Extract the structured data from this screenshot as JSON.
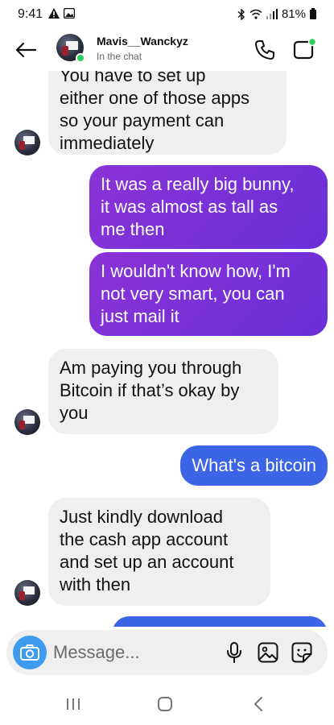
{
  "status_bar": {
    "time": "9:41",
    "battery": "81%"
  },
  "header": {
    "contact_name": "Mavis__Wanckyz",
    "contact_status": "In the chat"
  },
  "messages": [
    {
      "sender": "contact",
      "lines": [
        "You have to set up",
        "either one of those apps",
        "so your payment can",
        "immediately"
      ]
    },
    {
      "sender": "me",
      "lines": [
        "It was a really big bunny,",
        "it was almost as tall as",
        "me then"
      ]
    },
    {
      "sender": "me",
      "lines": [
        "I wouldn't know how, I'm",
        "not very smart, you can",
        "just mail it"
      ]
    },
    {
      "sender": "contact",
      "lines": [
        "Am paying you through",
        "Bitcoin if that’s okay by",
        "you"
      ]
    },
    {
      "sender": "me",
      "lines": [
        "What's a bitcoin"
      ]
    },
    {
      "sender": "contact",
      "lines": [
        "Just kindly download",
        "the cash app account",
        "and set up an account",
        "with then"
      ]
    }
  ],
  "composer": {
    "placeholder": "Message..."
  },
  "colors": {
    "outgoing_purple": "#7a31d8",
    "outgoing_blue": "#3b64e6",
    "incoming_bg": "#efefef",
    "camera_blue": "#3f9bef",
    "online_green": "#2ecc5a"
  },
  "icons": {
    "back": "arrow-left-icon",
    "call": "phone-icon",
    "video": "video-camera-icon",
    "camera": "camera-icon",
    "mic": "microphone-icon",
    "gallery": "image-icon",
    "sticker": "sticker-icon"
  }
}
